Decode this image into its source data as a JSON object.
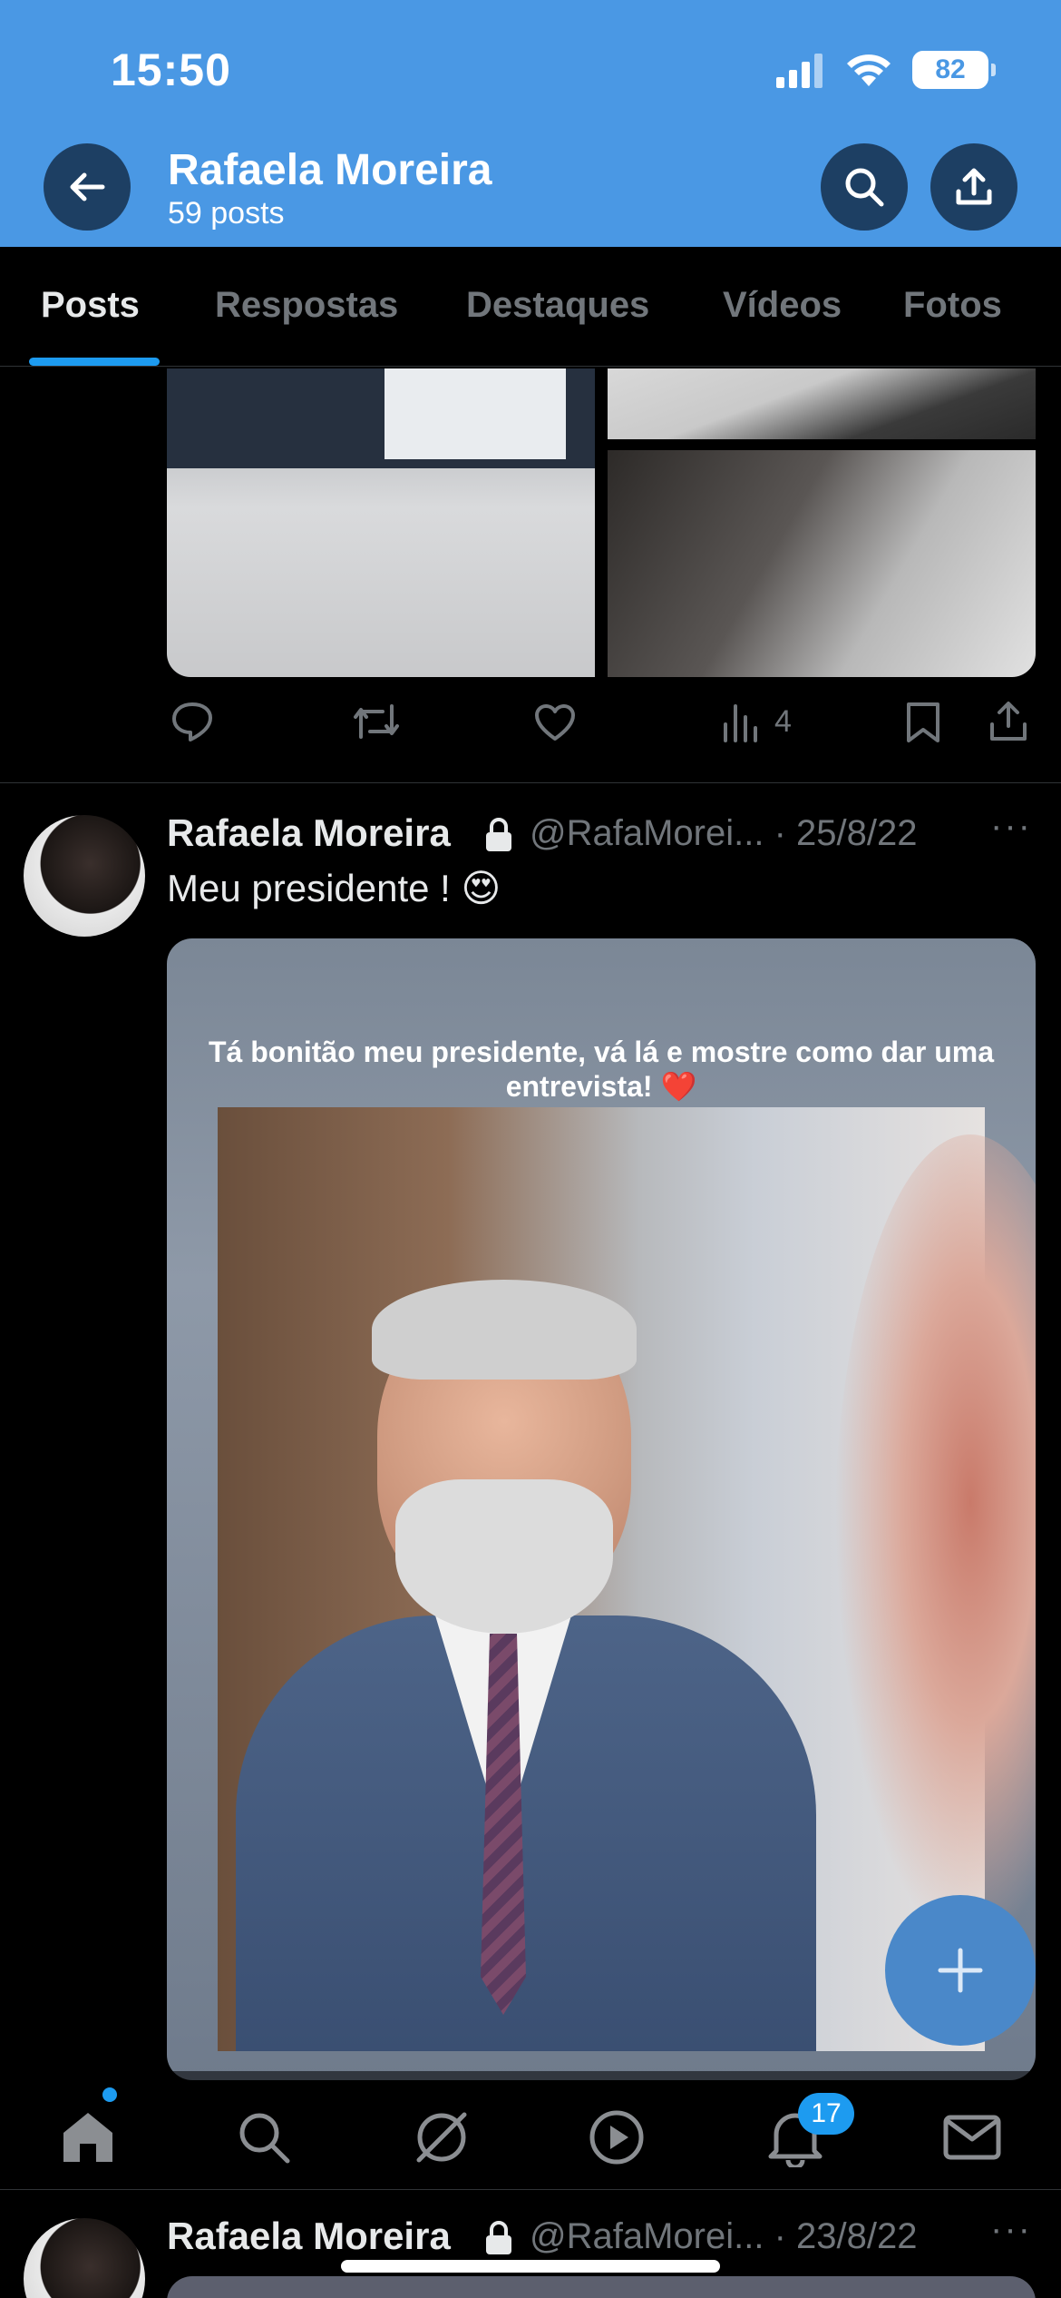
{
  "status_bar": {
    "time": "15:50",
    "battery": "82"
  },
  "header": {
    "name": "Rafaela Moreira",
    "post_count": "59 posts"
  },
  "tabs": [
    {
      "label": "Posts",
      "active": true
    },
    {
      "label": "Respostas",
      "active": false
    },
    {
      "label": "Destaques",
      "active": false
    },
    {
      "label": "Vídeos",
      "active": false
    },
    {
      "label": "Fotos",
      "active": false
    }
  ],
  "post_previous": {
    "views": "4"
  },
  "post_main": {
    "name": "Rafaela Moreira",
    "handle_date": "@RafaMorei... · 25/8/22",
    "text": "Meu presidente ! 😍",
    "image_caption": "Tá bonitão meu presidente, vá lá e mostre como dar uma entrevista! ❤️"
  },
  "post_next": {
    "name": "Rafaela Moreira",
    "handle_date": "@RafaMorei... · 23/8/22"
  },
  "bottom_nav": {
    "notifications_badge": "17"
  },
  "colors": {
    "header_bg": "#4a98e4",
    "accent": "#1d9bf0",
    "background": "#000000",
    "muted": "#71767b"
  }
}
